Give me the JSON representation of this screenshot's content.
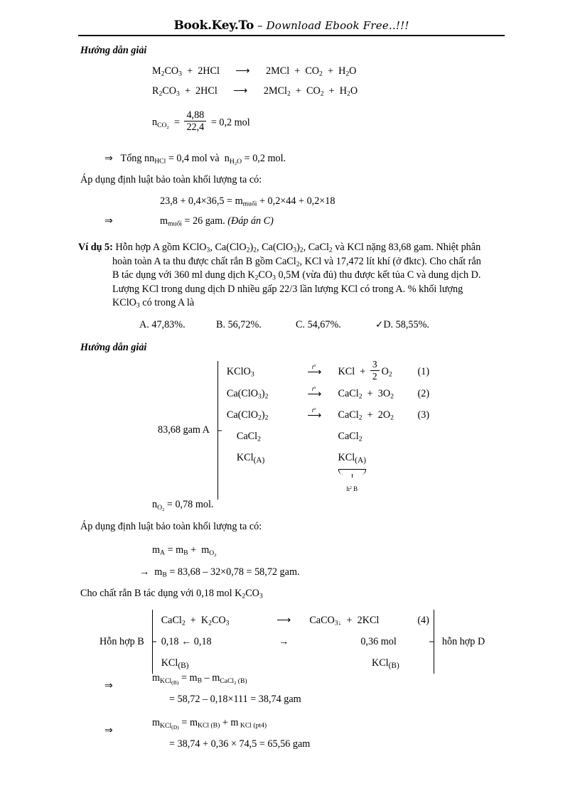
{
  "header": {
    "brand_main": "Book.Key.To",
    "brand_sep": " – ",
    "brand_sub": "Download Ebook Free..!!!"
  },
  "section1": {
    "heading": "Hướng dẫn giải",
    "eq1": {
      "left": "M2CO3  +  2HCl",
      "right": "2MCl  +  CO2  +  H2O"
    },
    "eq2": {
      "left": "R2CO3  +  2HCl",
      "right": "2MCl2  +  CO2  +  H2O"
    },
    "n_co2": {
      "label": "n",
      "sub": "CO2",
      "eq": "=",
      "num": "4,88",
      "den": "22,4",
      "result": "= 0,2 mol"
    },
    "line_tong": "Tổng n",
    "line_tong_hcl_sub": "HCl",
    "line_tong_val": "= 0,4 mol và",
    "line_tong_h2o": "n",
    "line_tong_h2o_sub": "H2O",
    "line_tong_h2o_val": "= 0,2 mol.",
    "blt_line": "Áp dụng định luật bảo toàn khối lượng ta có:",
    "mass_eq": "23,8 + 0,4×36,5 = m",
    "mass_eq_sub": "muối",
    "mass_eq_rest": " + 0,2×44 + 0,2×18",
    "result_m": "m",
    "result_m_sub": "muối",
    "result_m_rest": " = 26 gam. ",
    "result_answer": "(Đáp án C)",
    "arrow_double": "⇒"
  },
  "example5": {
    "label": "Ví dụ 5:",
    "text_line1": "Hỗn hợp A gồm KClO3, Ca(ClO2)2, Ca(ClO3)2, CaCl2 và KCl nặng 83,68 gam. Nhiệt phân",
    "text_line2": "hoàn toàn A ta thu được chất rắn B gồm CaCl2, KCl và 17,472 lít khí (ở đktc). Cho chất rắn",
    "text_line3": "B tác dụng với 360 ml dung dịch K2CO3 0,5M (vừa đủ) thu được kết tủa C và dung dịch D.",
    "text_line4": "Lượng KCl trong dung dịch D nhiều gấp 22/3 lần lượng KCl có trong A. % khối lượng",
    "text_line5": "KClO3 có trong A là",
    "options": [
      {
        "letter": "A.",
        "value": "47,83%.",
        "checked": false
      },
      {
        "letter": "B.",
        "value": "56,72%.",
        "checked": false
      },
      {
        "letter": "C.",
        "value": "54,67%.",
        "checked": false
      },
      {
        "letter": "D.",
        "value": "58,55%.",
        "checked": true
      }
    ],
    "check_mark": "✓"
  },
  "section2": {
    "heading": "Hướng dẫn giải",
    "brace_label": "83,68 gam A",
    "cond": "t",
    "cond_sup": "o",
    "rows": [
      {
        "lhs": "KClO3",
        "rhs_pre": "KCl  + ",
        "frac_num": "3",
        "frac_den": "2",
        "rhs_post": "O2",
        "num": "(1)",
        "arrow": true
      },
      {
        "lhs": "Ca(ClO3)2",
        "rhs_pre": "CaCl2  +  3O2",
        "num": "(2)",
        "arrow": true
      },
      {
        "lhs": "Ca(ClO2)2",
        "rhs_pre": "CaCl2  +  2O2",
        "num": "(3)",
        "arrow": true
      },
      {
        "lhs": "CaCl2",
        "rhs_pre": "CaCl2",
        "num": "",
        "arrow": false
      },
      {
        "lhs": "KCl(A)",
        "rhs_pre": "KCl(A)",
        "num": "",
        "arrow": false
      }
    ],
    "underbrace_label": "h2 B",
    "n_o2": "n",
    "n_o2_sub": "O2",
    "n_o2_val": "= 0,78 mol.",
    "blt_line": "Áp dụng định luật bảo toàn khối lượng ta có:",
    "ma_eq": "m",
    "ma_sub": "A",
    "ma_eq2": " = m",
    "mb_sub": "B",
    "ma_eq3": " +  m",
    "mo2_sub": "O2",
    "mb_line": "m",
    "mb_line_sub": "B",
    "mb_line_rest": " = 83,68 – 32×0,78 = 58,72 gam.",
    "arrow_single": "→",
    "cho_line": "Cho chất rắn B tác dụng với 0,18 mol K2CO3"
  },
  "section3": {
    "left_label": "Hỗn hợp B",
    "right_label": "hỗn hợp D",
    "row1_left": "CaCl2  +  K2CO3",
    "row1_right": "CaCO3↓  +  2KCl",
    "row1_num": "(4)",
    "row2_left": "0,18  ←  0,18",
    "row2_mid": "→",
    "row2_right": "0,36 mol",
    "row3_left": "KCl(B)",
    "row3_right": "KCl(B)",
    "calc1": {
      "arrow": "⇒",
      "lhs": "m",
      "lhs_sub": "KCl(B)",
      "mid": " = m",
      "mid_sub": "B",
      "minus": " – m",
      "minus_sub": "CaCl2 (B)",
      "line2": "= 58,72 – 0,18×111 = 38,74 gam"
    },
    "calc2": {
      "arrow": "⇒",
      "lhs": "m",
      "lhs_sub": "KCl(D)",
      "mid": " = m",
      "mid_sub": "KCl (B)",
      "plus": " + m",
      "plus_sub": "KCl (pt4)",
      "line2": "= 38,74 + 0,36 × 74,5 = 65,56 gam"
    }
  }
}
